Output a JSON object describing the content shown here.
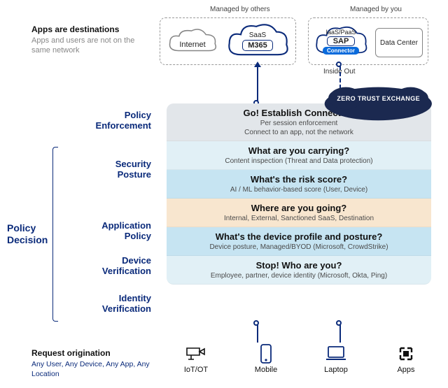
{
  "top": {
    "managed_others": "Managed by others",
    "managed_you": "Managed by you",
    "apps_heading": "Apps are destinations",
    "apps_sub": "Apps and users are not on the same network",
    "internet": "Internet",
    "saas_label": "SaaS",
    "saas_pill": "M365",
    "iaas_label": "IaaS/PaaS",
    "iaas_pill": "SAP",
    "connector": "Connector",
    "datacenter": "Data Center",
    "inside_out": "Inside Out"
  },
  "zte": "ZERO TRUST EXCHANGE",
  "sections": {
    "policy_enforcement": "Policy Enforcement",
    "security_posture": "Security Posture",
    "application_policy": "Application Policy",
    "device_verification": "Device Verification",
    "identity_verification": "Identity Verification",
    "policy_decision": "Policy Decision"
  },
  "layers": [
    {
      "q": "Go! Establish Connection",
      "d1": "Per session enforcement",
      "d2": "Connect to an app, not the network"
    },
    {
      "q": "What are you carrying?",
      "d": "Content inspection (Threat and Data protection)"
    },
    {
      "q": "What's the risk score?",
      "d": "AI / ML behavior-based score (User, Device)"
    },
    {
      "q": "Where are you going?",
      "d": "Internal, External, Sanctioned SaaS, Destination"
    },
    {
      "q": "What's the device profile and posture?",
      "d": "Device posture, Managed/BYOD (Microsoft, CrowdStrike)"
    },
    {
      "q": "Stop! Who are you?",
      "d": "Employee, partner, device identity (Microsoft, Okta, Ping)"
    }
  ],
  "bottom": {
    "heading": "Request origination",
    "sub": "Any User, Any Device, Any App, Any Location",
    "icons": [
      "IoT/OT",
      "Mobile",
      "Laptop",
      "Apps"
    ]
  }
}
